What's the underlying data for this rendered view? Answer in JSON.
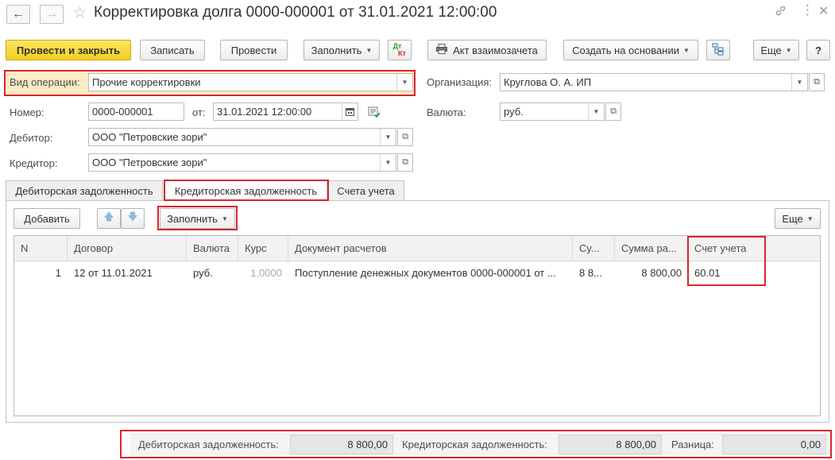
{
  "window": {
    "title": "Корректировка долга 0000-000001 от 31.01.2021 12:00:00"
  },
  "toolbar": {
    "post_close": "Провести и закрыть",
    "save": "Записать",
    "post": "Провести",
    "fill": "Заполнить",
    "dt_kt": "Дт Кт",
    "dt": "Дт",
    "kt": "Кт",
    "act": "Акт взаимозачета",
    "create_based": "Создать на основании",
    "more": "Еще",
    "help": "?"
  },
  "form": {
    "operation_label": "Вид операции:",
    "operation_value": "Прочие корректировки",
    "org_label": "Организация:",
    "org_value": "Круглова О. А. ИП",
    "number_label": "Номер:",
    "number_value": "0000-000001",
    "date_label": "от:",
    "date_value": "31.01.2021 12:00:00",
    "currency_label": "Валюта:",
    "currency_value": "руб.",
    "debtor_label": "Дебитор:",
    "debtor_value": "ООО \"Петровские зори\"",
    "creditor_label": "Кредитор:",
    "creditor_value": "ООО \"Петровские зори\""
  },
  "tabs": [
    {
      "label": "Дебиторская задолженность",
      "active": false
    },
    {
      "label": "Кредиторская задолженность",
      "active": true
    },
    {
      "label": "Счета учета",
      "active": false
    }
  ],
  "table_toolbar": {
    "add": "Добавить",
    "fill": "Заполнить",
    "more": "Еще"
  },
  "table": {
    "columns": [
      "N",
      "Договор",
      "Валюта",
      "Курс",
      "Документ расчетов",
      "Су...",
      "Сумма ра...",
      "Счет учета"
    ],
    "rows": [
      {
        "n": "1",
        "contract": "12 от 11.01.2021",
        "currency": "руб.",
        "rate": "1,0000",
        "doc": "Поступление денежных документов 0000-000001 от ...",
        "sum": "8 8...",
        "sum_calc": "8 800,00",
        "account": "60.01"
      }
    ]
  },
  "footer": {
    "debit_label": "Дебиторская задолженность:",
    "debit_value": "8 800,00",
    "credit_label": "Кредиторская задолженность:",
    "credit_value": "8 800,00",
    "diff_label": "Разница:",
    "diff_value": "0,00"
  },
  "colors": {
    "accent_yellow": "#f2cf1f",
    "highlight_red": "#d9252c",
    "dt_kt_green": "#2e9e3f",
    "dt_kt_red": "#d42a2a"
  }
}
